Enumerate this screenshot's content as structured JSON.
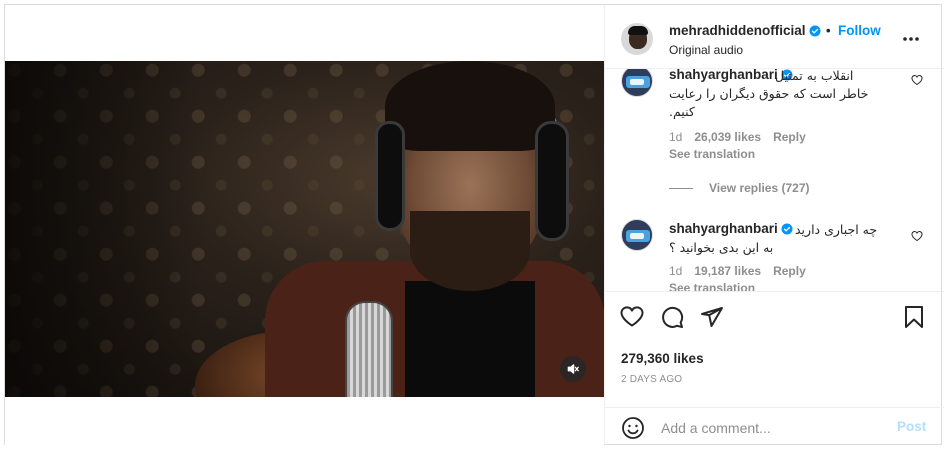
{
  "post": {
    "username": "mehradhiddenofficial",
    "separator": "•",
    "follow_label": "Follow",
    "audio_label": "Original audio",
    "more_icon": "more-horizontal-icon",
    "verified_color": "#0095f6"
  },
  "comments": [
    {
      "username": "shahyarghanbari",
      "verified": true,
      "text_line1": "انقلاب به تمثیل",
      "text_line2": "خاطر است که حقوق دیگران را رعایت",
      "text_line3": "کنیم.",
      "age": "1d",
      "likes": "26,039 likes",
      "reply_label": "Reply",
      "see_translation": "See translation",
      "view_replies": "View replies (727)"
    },
    {
      "username": "shahyarghanbari",
      "verified": true,
      "text_line1": "چه اجباری دارید",
      "text_line2": "به این بدی بخوانید ؟",
      "age": "1d",
      "likes": "19,187 likes",
      "reply_label": "Reply",
      "see_translation": "See translation"
    }
  ],
  "actions": {
    "like_icon": "heart-icon",
    "comment_icon": "comment-icon",
    "share_icon": "share-icon",
    "save_icon": "bookmark-icon",
    "likes_count": "279,360 likes",
    "posted_ago": "2 DAYS AGO"
  },
  "composer": {
    "placeholder": "Add a comment...",
    "post_label": "Post",
    "emoji_icon": "emoji-icon"
  },
  "video": {
    "mute_icon": "speaker-muted-icon"
  },
  "colors": {
    "accent": "#0095f6",
    "post_disabled": "#b2dffc",
    "muted_text": "#8e8e8e"
  }
}
